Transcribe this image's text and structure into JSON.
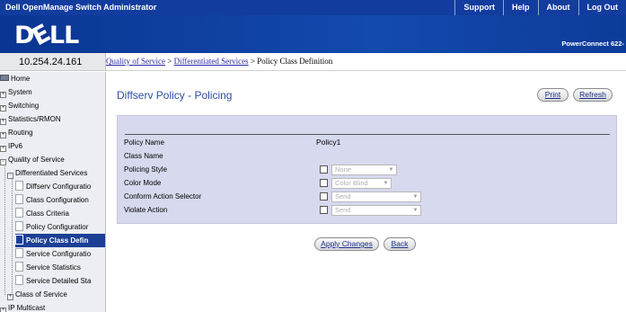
{
  "app": {
    "title": "Dell OpenManage Switch Administrator",
    "logo": "DELL",
    "model": "PowerConnect 622‑"
  },
  "topnav": [
    "Support",
    "Help",
    "About",
    "Log Out"
  ],
  "ip_address": "10.254.24.161",
  "breadcrumb": {
    "part1": "Quality of Service",
    "sep1": " > ",
    "part2": "Differentiated Services",
    "sep2": " > ",
    "current": "Policy Class Definition"
  },
  "sidebar": {
    "items": [
      {
        "label": "Home"
      },
      {
        "label": "System",
        "pm": "+"
      },
      {
        "label": "Switching",
        "pm": "+"
      },
      {
        "label": "Statistics/RMON",
        "pm": "+"
      },
      {
        "label": "Routing",
        "pm": "+"
      },
      {
        "label": "IPv6",
        "pm": "+"
      },
      {
        "label": "Quality of Service",
        "pm": "−"
      },
      {
        "label": "Differentiated Services",
        "pm": "−"
      },
      {
        "label": "Diffserv Configuratio"
      },
      {
        "label": "Class Configuration"
      },
      {
        "label": "Class Criteria"
      },
      {
        "label": "Policy Configuratior"
      },
      {
        "label": "Policy Class Defin"
      },
      {
        "label": "Service Configuratio"
      },
      {
        "label": "Service Statistics"
      },
      {
        "label": "Service Detailed Sta"
      },
      {
        "label": "Class of Service",
        "pm": "+"
      },
      {
        "label": "IP Multicast",
        "pm": "+"
      }
    ]
  },
  "page": {
    "title": "Diffserv Policy - Policing",
    "print_label": "Print",
    "refresh_label": "Refresh",
    "apply_label": "Apply Changes",
    "back_label": "Back"
  },
  "form": {
    "policy_name_label": "Policy Name",
    "policy_name_value": "Policy1",
    "class_name_label": "Class Name",
    "policing_style_label": "Policing Style",
    "policing_style_value": "None",
    "color_mode_label": "Color Mode",
    "color_mode_value": "Color Blind",
    "conform_label": "Conform Action Selector",
    "conform_value": "Send",
    "violate_label": "Violate Action",
    "violate_value": "Send"
  },
  "colors": {
    "topbar": "#123c9e",
    "header": "#0b3a9a",
    "selected": "#1c3f96",
    "panel": "#d7d9ee",
    "title": "#2b4fa0"
  }
}
